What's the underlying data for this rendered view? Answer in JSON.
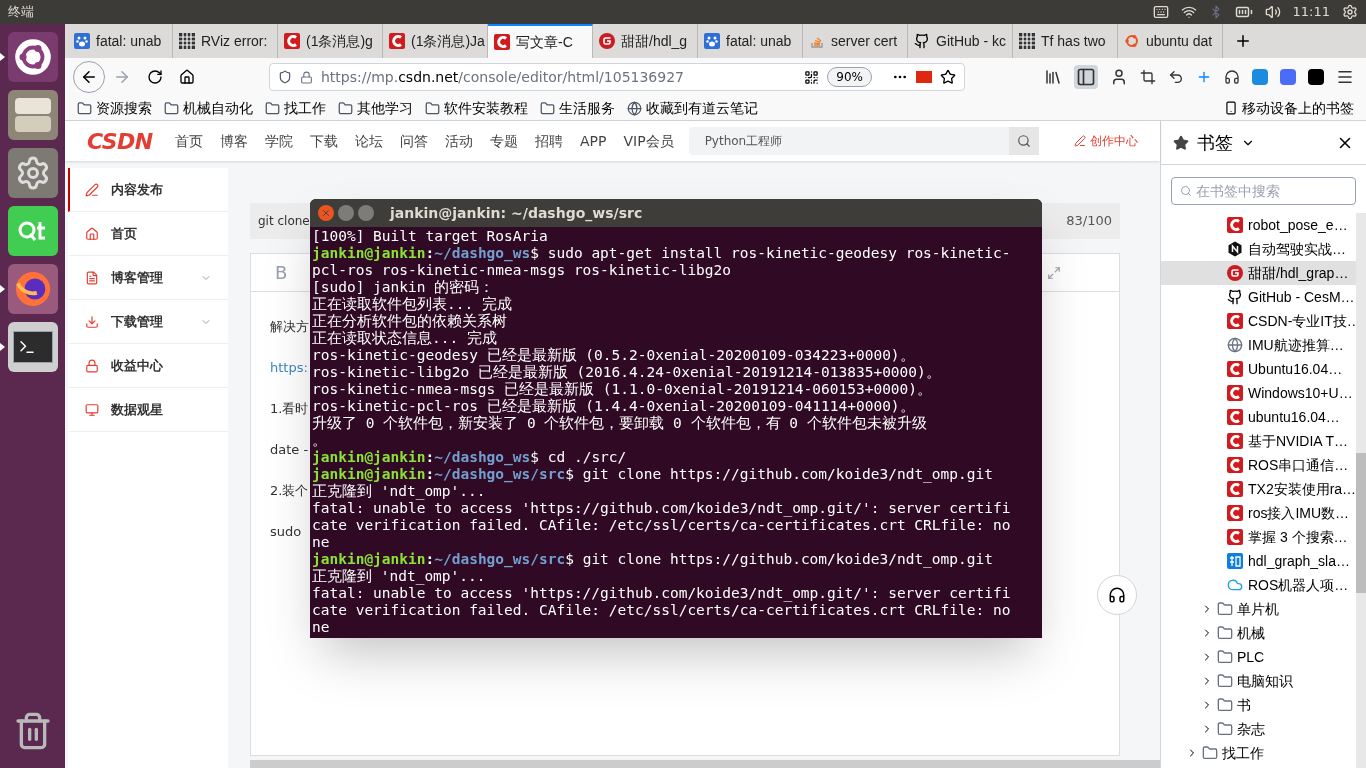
{
  "top_bar": {
    "title": "终端",
    "time": "11:11"
  },
  "launcher": [
    {
      "kind": "ubuntu",
      "selected": true
    },
    {
      "kind": "files",
      "selected": false
    },
    {
      "kind": "settings",
      "selected": false
    },
    {
      "kind": "qt",
      "selected": false
    },
    {
      "kind": "firefox",
      "selected": true
    },
    {
      "kind": "terminal",
      "selected": true
    },
    {
      "kind": "trash",
      "selected": false
    }
  ],
  "tabs": [
    {
      "kind": "paw",
      "label": "fatal: unab",
      "selected": false
    },
    {
      "kind": "grid",
      "label": "RViz error:",
      "selected": false
    },
    {
      "kind": "csdn",
      "label": "(1条消息)g",
      "selected": false
    },
    {
      "kind": "csdn",
      "label": "(1条消息)Ja",
      "selected": false
    },
    {
      "kind": "csdn",
      "label": "写文章-C",
      "selected": true
    },
    {
      "kind": "gitee",
      "label": "甜甜/hdl_g",
      "selected": false
    },
    {
      "kind": "paw",
      "label": "fatal: unab",
      "selected": false
    },
    {
      "kind": "stack",
      "label": "server cert",
      "selected": false
    },
    {
      "kind": "github",
      "label": "GitHub - kc",
      "selected": false
    },
    {
      "kind": "grid",
      "label": "Tf has two",
      "selected": false
    },
    {
      "kind": "ubuntu",
      "label": "ubuntu dat",
      "selected": false
    }
  ],
  "address": {
    "url_prefix": "https://mp.",
    "url_domain": "csdn.net",
    "url_rest": "/console/editor/html/105136927",
    "zoom": "90%"
  },
  "bookmarks_bar": [
    "资源搜索",
    "机械自动化",
    "找工作",
    "其他学习",
    "软件安装教程",
    "生活服务"
  ],
  "bookmarks_bar_extra": "收藏到有道云笔记",
  "mobile_bookmarks": "移动设备上的书签",
  "csdn": {
    "logo": "CSDN",
    "nav": [
      "首页",
      "博客",
      "学院",
      "下载",
      "论坛",
      "问答",
      "活动",
      "专题",
      "招聘",
      "APP",
      "VIP会员"
    ],
    "search": "Python工程师",
    "create": "创作中心",
    "menu": [
      {
        "kind": "pen",
        "label": "内容发布",
        "selected": true,
        "expandable": false
      },
      {
        "kind": "home",
        "label": "首页",
        "selected": false,
        "expandable": false
      },
      {
        "kind": "doc",
        "label": "博客管理",
        "selected": false,
        "expandable": true
      },
      {
        "kind": "download",
        "label": "下载管理",
        "selected": false,
        "expandable": true
      },
      {
        "kind": "lock",
        "label": "收益中心",
        "selected": false,
        "expandable": false
      },
      {
        "kind": "monitor",
        "label": "数据观星",
        "selected": false,
        "expandable": false
      }
    ],
    "title_value": "git clone",
    "title_count": "83/100",
    "bold_tool": "B",
    "body": [
      {
        "kind": "text",
        "text": "解决方"
      },
      {
        "kind": "link",
        "text": "https:"
      },
      {
        "kind": "text",
        "text": "1.看时"
      },
      {
        "kind": "text",
        "text": "date -"
      },
      {
        "kind": "text",
        "text": "2.装个"
      },
      {
        "kind": "text",
        "text": "sudo"
      }
    ]
  },
  "terminal": {
    "title": "jankin@jankin: ~/dashgo_ws/src",
    "lines": [
      {
        "kind": "output",
        "text": "[100%] Built target RosAria"
      },
      {
        "kind": "prompt",
        "user": "jankin@jankin",
        "separator": ":",
        "path": "~/dashgo_ws",
        "sigil": "$",
        "command": " sudo apt-get install ros-kinetic-geodesy ros-kinetic-"
      },
      {
        "kind": "output",
        "text": "pcl-ros ros-kinetic-nmea-msgs ros-kinetic-libg2o"
      },
      {
        "kind": "output",
        "text": "[sudo] jankin 的密码："
      },
      {
        "kind": "output",
        "text": "正在读取软件包列表... 完成"
      },
      {
        "kind": "output",
        "text": "正在分析软件包的依赖关系树"
      },
      {
        "kind": "output",
        "text": "正在读取状态信息... 完成"
      },
      {
        "kind": "output",
        "text": "ros-kinetic-geodesy 已经是最新版 (0.5.2-0xenial-20200109-034223+0000)。"
      },
      {
        "kind": "output",
        "text": "ros-kinetic-libg2o 已经是最新版 (2016.4.24-0xenial-20191214-013835+0000)。"
      },
      {
        "kind": "output",
        "text": "ros-kinetic-nmea-msgs 已经是最新版 (1.1.0-0xenial-20191214-060153+0000)。"
      },
      {
        "kind": "output",
        "text": "ros-kinetic-pcl-ros 已经是最新版 (1.4.4-0xenial-20200109-041114+0000)。"
      },
      {
        "kind": "output",
        "text": "升级了 0 个软件包，新安装了 0 个软件包，要卸载 0 个软件包，有 0 个软件包未被升级"
      },
      {
        "kind": "output",
        "text": "。"
      },
      {
        "kind": "prompt",
        "user": "jankin@jankin",
        "separator": ":",
        "path": "~/dashgo_ws",
        "sigil": "$",
        "command": " cd ./src/"
      },
      {
        "kind": "prompt",
        "user": "jankin@jankin",
        "separator": ":",
        "path": "~/dashgo_ws/src",
        "sigil": "$",
        "command": " git clone https://github.com/koide3/ndt_omp.git"
      },
      {
        "kind": "output",
        "text": "正克隆到 'ndt_omp'..."
      },
      {
        "kind": "output",
        "text": "fatal: unable to access 'https://github.com/koide3/ndt_omp.git/': server certifi"
      },
      {
        "kind": "output",
        "text": "cate verification failed. CAfile: /etc/ssl/certs/ca-certificates.crt CRLfile: no"
      },
      {
        "kind": "output",
        "text": "ne"
      },
      {
        "kind": "prompt",
        "user": "jankin@jankin",
        "separator": ":",
        "path": "~/dashgo_ws/src",
        "sigil": "$",
        "command": " git clone https://github.com/koide3/ndt_omp.git"
      },
      {
        "kind": "output",
        "text": "正克隆到 'ndt_omp'..."
      },
      {
        "kind": "output",
        "text": "fatal: unable to access 'https://github.com/koide3/ndt_omp.git/': server certifi"
      },
      {
        "kind": "output",
        "text": "cate verification failed. CAfile: /etc/ssl/certs/ca-certificates.crt CRLfile: no"
      },
      {
        "kind": "output",
        "text": "ne"
      }
    ]
  },
  "sidebar": {
    "title": "书签",
    "search_placeholder": "在书签中搜索",
    "items": [
      {
        "kind": "csdn",
        "label": "robot_pose_e…",
        "selected": false
      },
      {
        "kind": "notion",
        "label": "自动驾驶实战…",
        "selected": false
      },
      {
        "kind": "gitee",
        "label": "甜甜/hdl_grap…",
        "selected": true
      },
      {
        "kind": "github",
        "label": "GitHub - CesM…",
        "selected": false
      },
      {
        "kind": "csdn",
        "label": "CSDN-专业IT技…",
        "selected": false
      },
      {
        "kind": "globe",
        "label": "IMU航迹推算…",
        "selected": false
      },
      {
        "kind": "csdn",
        "label": "Ubuntu16.04…",
        "selected": false
      },
      {
        "kind": "csdn",
        "label": "Windows10+U…",
        "selected": false
      },
      {
        "kind": "csdn",
        "label": "ubuntu16.04…",
        "selected": false
      },
      {
        "kind": "csdn",
        "label": "基于NVIDIA T…",
        "selected": false
      },
      {
        "kind": "csdn",
        "label": "ROS串口通信…",
        "selected": false
      },
      {
        "kind": "csdn",
        "label": "TX2安装使用ra…",
        "selected": false
      },
      {
        "kind": "csdn",
        "label": "ros接入IMU数…",
        "selected": false
      },
      {
        "kind": "csdn",
        "label": "掌握 3 个搜索…",
        "selected": false
      },
      {
        "kind": "zhihu",
        "label": "hdl_graph_sla…",
        "selected": false
      },
      {
        "kind": "cloud",
        "label": "ROS机器人项…",
        "selected": false
      },
      {
        "kind": "folder",
        "label": "单片机",
        "expanded": false
      },
      {
        "kind": "folder",
        "label": "机械",
        "expanded": false
      },
      {
        "kind": "folder",
        "label": "PLC",
        "expanded": false
      },
      {
        "kind": "folder",
        "label": "电脑知识",
        "expanded": false
      },
      {
        "kind": "folder",
        "label": "书",
        "expanded": false
      },
      {
        "kind": "folder",
        "label": "杂志",
        "expanded": false
      },
      {
        "kind": "topfolder",
        "label": "找工作",
        "expanded": false
      }
    ]
  }
}
